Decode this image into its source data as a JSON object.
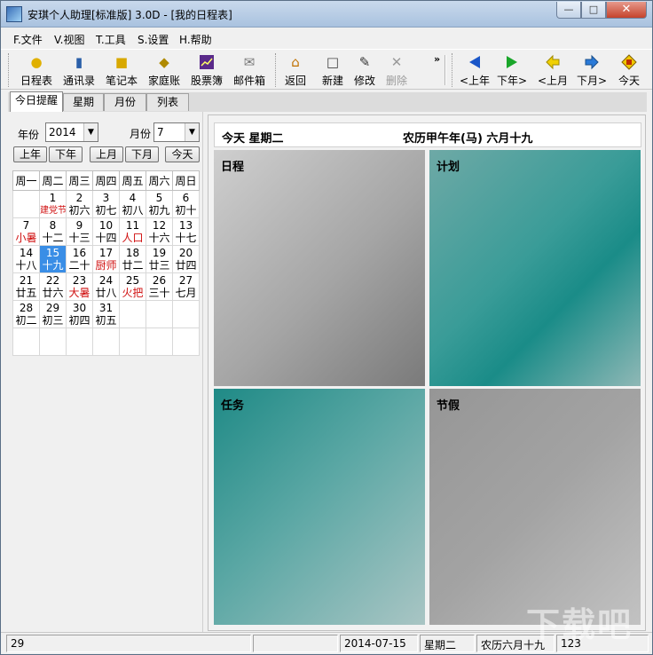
{
  "window": {
    "title": "安琪个人助理[标准版] 3.0D - [我的日程表]"
  },
  "menu": [
    "F.文件",
    "V.视图",
    "T.工具",
    "S.设置",
    "H.帮助"
  ],
  "toolbar": {
    "items": [
      {
        "label": "日程表",
        "icon": "bell-icon"
      },
      {
        "label": "通讯录",
        "icon": "contacts-icon"
      },
      {
        "label": "笔记本",
        "icon": "notebook-icon"
      },
      {
        "label": "家庭账",
        "icon": "money-icon"
      },
      {
        "label": "股票簿",
        "icon": "stock-chart-icon"
      },
      {
        "label": "邮件箱",
        "icon": "mail-icon"
      },
      {
        "label": "返回",
        "icon": "home-icon"
      },
      {
        "label": "新建",
        "icon": "new-doc-icon"
      },
      {
        "label": "修改",
        "icon": "edit-icon"
      },
      {
        "label": "删除",
        "icon": "delete-icon"
      },
      {
        "label": "<上年",
        "icon": "arrow-left-icon"
      },
      {
        "label": "下年>",
        "icon": "arrow-right-icon"
      },
      {
        "label": "<上月",
        "icon": "arrow-left-yellow-icon"
      },
      {
        "label": "下月>",
        "icon": "arrow-right-blue-icon"
      },
      {
        "label": "今天",
        "icon": "today-icon"
      }
    ],
    "more": "»"
  },
  "tabs": [
    "今日提醒",
    "星期",
    "月份",
    "列表"
  ],
  "picker": {
    "year_label": "年份",
    "year_value": "2014",
    "month_label": "月份",
    "month_value": "7",
    "buttons": [
      "上年",
      "下年",
      "上月",
      "下月",
      "今天"
    ]
  },
  "calendar": {
    "weekdays": [
      "周一",
      "周二",
      "周三",
      "周四",
      "周五",
      "周六",
      "周日"
    ],
    "weeks": [
      [
        {
          "d": "",
          "l": ""
        },
        {
          "d": "1",
          "l": "建党节/香港回归",
          "red": true,
          "small": true
        },
        {
          "d": "2",
          "l": "初六"
        },
        {
          "d": "3",
          "l": "初七"
        },
        {
          "d": "4",
          "l": "初八"
        },
        {
          "d": "5",
          "l": "初九"
        },
        {
          "d": "6",
          "l": "初十"
        }
      ],
      [
        {
          "d": "7",
          "l": "小暑",
          "red": true
        },
        {
          "d": "8",
          "l": "十二"
        },
        {
          "d": "9",
          "l": "十三"
        },
        {
          "d": "10",
          "l": "十四"
        },
        {
          "d": "11",
          "l": "人口",
          "red": true
        },
        {
          "d": "12",
          "l": "十六"
        },
        {
          "d": "13",
          "l": "十七"
        }
      ],
      [
        {
          "d": "14",
          "l": "十八"
        },
        {
          "d": "15",
          "l": "十九",
          "today": true
        },
        {
          "d": "16",
          "l": "二十"
        },
        {
          "d": "17",
          "l": "厨师",
          "red": true
        },
        {
          "d": "18",
          "l": "廿二"
        },
        {
          "d": "19",
          "l": "廿三"
        },
        {
          "d": "20",
          "l": "廿四"
        }
      ],
      [
        {
          "d": "21",
          "l": "廿五"
        },
        {
          "d": "22",
          "l": "廿六"
        },
        {
          "d": "23",
          "l": "大暑",
          "red": true
        },
        {
          "d": "24",
          "l": "廿八"
        },
        {
          "d": "25",
          "l": "火把",
          "red": true
        },
        {
          "d": "26",
          "l": "三十"
        },
        {
          "d": "27",
          "l": "七月"
        }
      ],
      [
        {
          "d": "28",
          "l": "初二"
        },
        {
          "d": "29",
          "l": "初三"
        },
        {
          "d": "30",
          "l": "初四"
        },
        {
          "d": "31",
          "l": "初五"
        },
        {
          "d": "",
          "l": ""
        },
        {
          "d": "",
          "l": ""
        },
        {
          "d": "",
          "l": ""
        }
      ],
      [
        {
          "d": "",
          "l": ""
        },
        {
          "d": "",
          "l": ""
        },
        {
          "d": "",
          "l": ""
        },
        {
          "d": "",
          "l": ""
        },
        {
          "d": "",
          "l": ""
        },
        {
          "d": "",
          "l": ""
        },
        {
          "d": "",
          "l": ""
        }
      ]
    ]
  },
  "main": {
    "today_text": "今天  星期二",
    "lunar_text": "农历甲午年(马) 六月十九",
    "panels": [
      "日程",
      "计划",
      "任务",
      "节假"
    ]
  },
  "status": {
    "count": "29",
    "empty": "",
    "date": "2014-07-15",
    "weekday": "星期二",
    "lunar": "农历六月十九",
    "code": "123"
  },
  "watermark": "下载吧"
}
